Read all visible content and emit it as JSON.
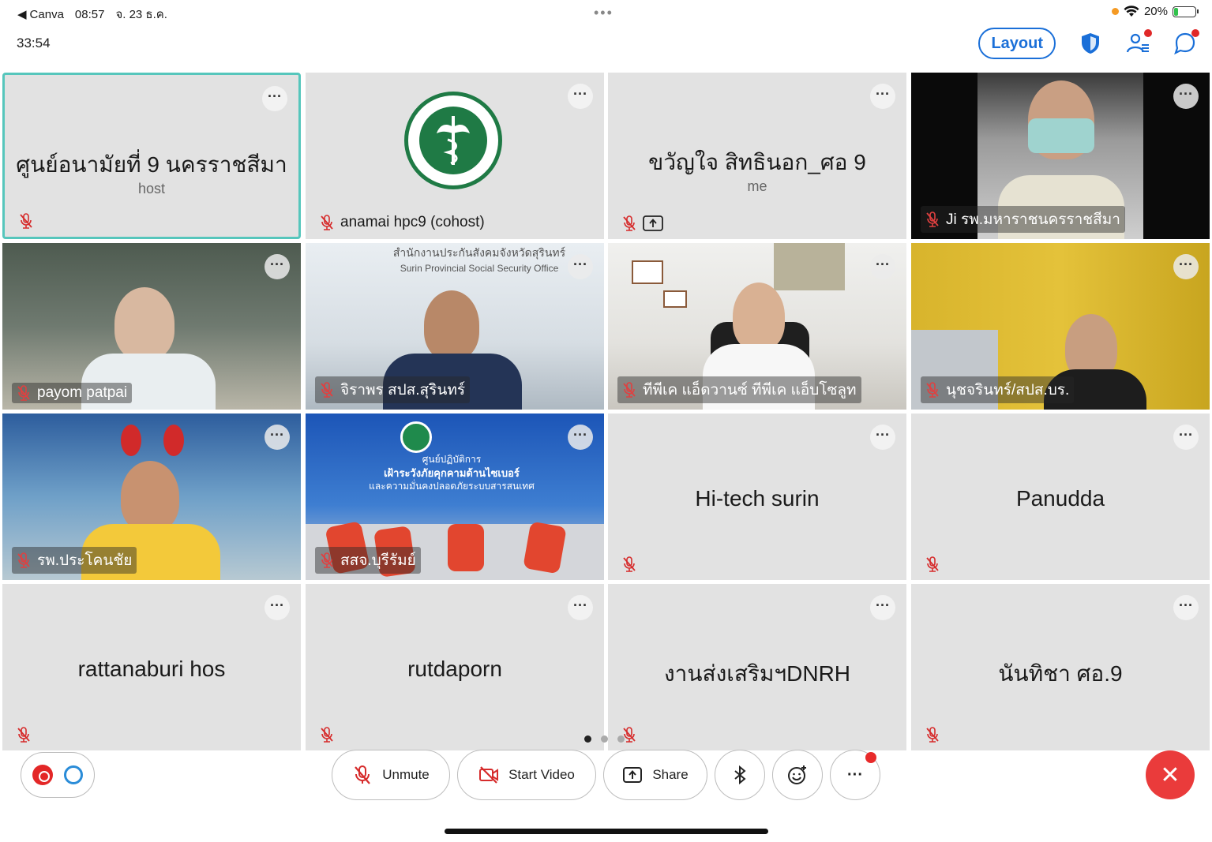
{
  "statusbar": {
    "app": "Canva",
    "time": "08:57",
    "date": "จ. 23 ธ.ค.",
    "battery": "20%",
    "battery_level": 0.2,
    "dots": "•••"
  },
  "meeting": {
    "elapsed": "33:54",
    "layout_label": "Layout"
  },
  "tiles": [
    {
      "name": "ศูนย์อนามัยที่ 9 นครราชสีมา",
      "role": "host",
      "label": ""
    },
    {
      "name": "",
      "role": "",
      "label": "anamai hpc9 (cohost)"
    },
    {
      "name": "ขวัญใจ สิทธินอก_ศอ 9",
      "role": "me",
      "label": ""
    },
    {
      "name": "",
      "role": "",
      "label": "Ji รพ.มหาราชนครราชสีมา"
    },
    {
      "name": "",
      "role": "",
      "label": "payom patpai"
    },
    {
      "name": "",
      "role": "",
      "label": "จิราพร สปส.สุรินทร์"
    },
    {
      "name": "",
      "role": "",
      "label": "ทีพีเค แอ็ดวานซ์ ทีพีเค แอ็บโซลูท"
    },
    {
      "name": "",
      "role": "",
      "label": "นุชจรินทร์/สปส.บร."
    },
    {
      "name": "",
      "role": "",
      "label": "รพ.ประโคนชัย"
    },
    {
      "name": "",
      "role": "",
      "label": "สสจ.บุรีรัมย์"
    },
    {
      "name": "Hi-tech surin",
      "role": "",
      "label": ""
    },
    {
      "name": "Panudda",
      "role": "",
      "label": ""
    },
    {
      "name": "rattanaburi hos",
      "role": "",
      "label": ""
    },
    {
      "name": "rutdaporn",
      "role": "",
      "label": ""
    },
    {
      "name": "งานส่งเสริมฯDNRH",
      "role": "",
      "label": ""
    },
    {
      "name": "นันทิชา ศอ.9",
      "role": "",
      "label": ""
    }
  ],
  "backdrop_text": {
    "office_sign_th": "สำนักงานประกันสังคมจังหวัดสุรินทร์",
    "office_sign_en": "Surin Provincial Social Security Office",
    "screen_line1": "ศูนย์ปฏิบัติการ",
    "screen_line2": "เฝ้าระวังภัยคุกคามด้านไซเบอร์",
    "screen_line3": "และความมั่นคงปลอดภัยระบบสารสนเทศ"
  },
  "toolbar": {
    "unmute": "Unmute",
    "start_video": "Start Video",
    "share": "Share",
    "more": "···"
  },
  "more_glyph": "···",
  "leave_glyph": "✕",
  "colors": {
    "accent": "#1a6fd8",
    "active_border": "#56c6bc",
    "leave": "#ea3b3b",
    "muted": "#d62b2b"
  }
}
